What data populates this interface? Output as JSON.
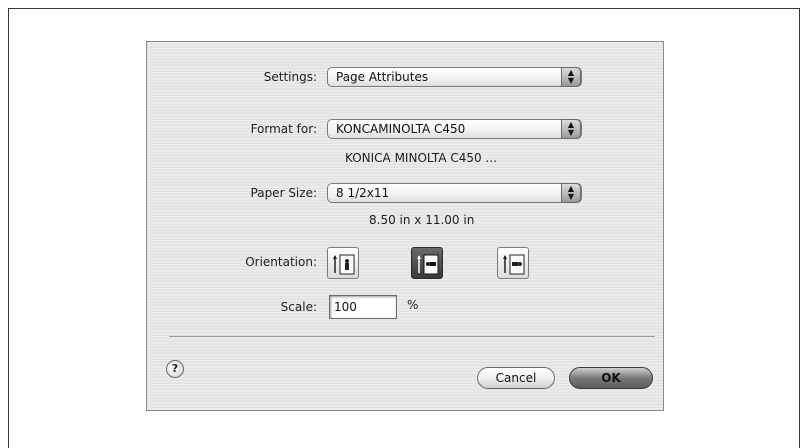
{
  "dialog": {
    "settings": {
      "label": "Settings:",
      "value": "Page Attributes"
    },
    "format_for": {
      "label": "Format for:",
      "value": "KONCAMINOLTA C450",
      "description": "KONICA MINOLTA C450 ..."
    },
    "paper_size": {
      "label": "Paper Size:",
      "value": "8 1/2x11",
      "dimensions": "8.50 in x 11.00 in"
    },
    "orientation": {
      "label": "Orientation:",
      "options": [
        "portrait",
        "landscape",
        "landscape-reversed"
      ],
      "selected": "landscape"
    },
    "scale": {
      "label": "Scale:",
      "value": "100",
      "unit": "%"
    },
    "buttons": {
      "help": "?",
      "cancel": "Cancel",
      "ok": "OK"
    }
  },
  "colors": {
    "dialog_bg": "#e6e6e6",
    "selected_orientation": "#4a4a4a"
  }
}
